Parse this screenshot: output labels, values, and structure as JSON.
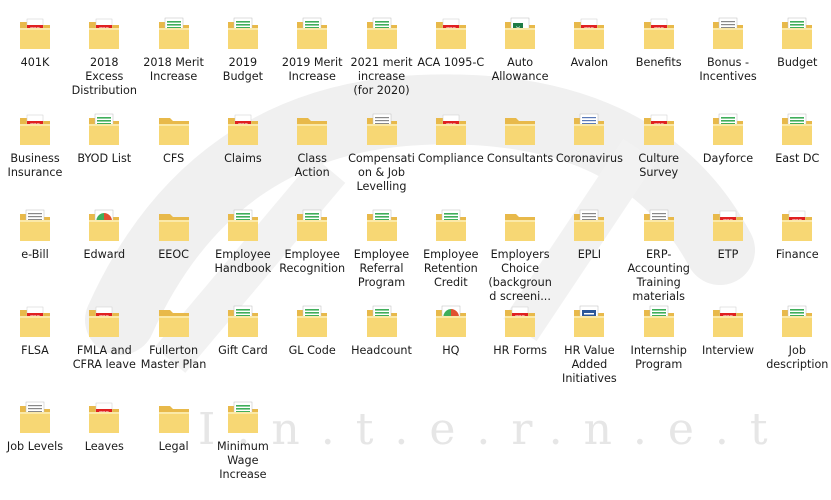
{
  "explorer": {
    "watermark_text": "I.n.t.e.r.n.e.t",
    "items": [
      {
        "label": "401K",
        "icon": "pdf"
      },
      {
        "label": "2018 Excess Distribution",
        "icon": "pdf"
      },
      {
        "label": "2018 Merit Increase",
        "icon": "sheet"
      },
      {
        "label": "2019 Budget",
        "icon": "sheet"
      },
      {
        "label": "2019 Merit Increase",
        "icon": "sheet"
      },
      {
        "label": "2021 merit increase (for 2020)",
        "icon": "sheet"
      },
      {
        "label": "ACA 1095-C",
        "icon": "pdf"
      },
      {
        "label": "Auto Allowance",
        "icon": "excel"
      },
      {
        "label": "Avalon",
        "icon": "pdf"
      },
      {
        "label": "Benefits",
        "icon": "pdf"
      },
      {
        "label": "Bonus - Incentives",
        "icon": "doc"
      },
      {
        "label": "Budget",
        "icon": "sheet"
      },
      {
        "label": "Business Insurance",
        "icon": "pdf"
      },
      {
        "label": "BYOD List",
        "icon": "sheet"
      },
      {
        "label": "CFS",
        "icon": "empty"
      },
      {
        "label": "Claims",
        "icon": "pdf"
      },
      {
        "label": "Class Action",
        "icon": "empty"
      },
      {
        "label": "Compensation & Job Levelling",
        "icon": "doc"
      },
      {
        "label": "Compliance",
        "icon": "pdf"
      },
      {
        "label": "Consultants",
        "icon": "empty"
      },
      {
        "label": "Coronavirus",
        "icon": "docblue"
      },
      {
        "label": "Culture Survey",
        "icon": "pdf"
      },
      {
        "label": "Dayforce",
        "icon": "sheet"
      },
      {
        "label": "East DC",
        "icon": "sheet"
      },
      {
        "label": "e-Bill",
        "icon": "doc"
      },
      {
        "label": "Edward",
        "icon": "chart"
      },
      {
        "label": "EEOC",
        "icon": "empty"
      },
      {
        "label": "Employee Handbook",
        "icon": "sheet"
      },
      {
        "label": "Employee Recognition",
        "icon": "sheet"
      },
      {
        "label": "Employee Referral Program",
        "icon": "sheet"
      },
      {
        "label": "Employee Retention Credit",
        "icon": "sheet"
      },
      {
        "label": "Employers Choice (background screeni...",
        "icon": "empty"
      },
      {
        "label": "EPLI",
        "icon": "doc"
      },
      {
        "label": "ERP-Accounting Training materials",
        "icon": "doc"
      },
      {
        "label": "ETP",
        "icon": "pdf"
      },
      {
        "label": "Finance",
        "icon": "pdf"
      },
      {
        "label": "FLSA",
        "icon": "pdf"
      },
      {
        "label": "FMLA and CFRA leave",
        "icon": "pdf"
      },
      {
        "label": "Fullerton Master Plan",
        "icon": "empty"
      },
      {
        "label": "Gift Card",
        "icon": "sheet"
      },
      {
        "label": "GL Code",
        "icon": "sheet"
      },
      {
        "label": "Headcount",
        "icon": "sheet"
      },
      {
        "label": "HQ",
        "icon": "chart"
      },
      {
        "label": "HR Forms",
        "icon": "pdf"
      },
      {
        "label": "HR Value Added Initiatives",
        "icon": "word"
      },
      {
        "label": "Internship Program",
        "icon": "sheet"
      },
      {
        "label": "Interview",
        "icon": "pdf"
      },
      {
        "label": "Job description",
        "icon": "sheet"
      },
      {
        "label": "Job Levels",
        "icon": "doc"
      },
      {
        "label": "Leaves",
        "icon": "pdf"
      },
      {
        "label": "Legal",
        "icon": "empty"
      },
      {
        "label": "Minimum Wage Increase",
        "icon": "sheet"
      }
    ]
  }
}
